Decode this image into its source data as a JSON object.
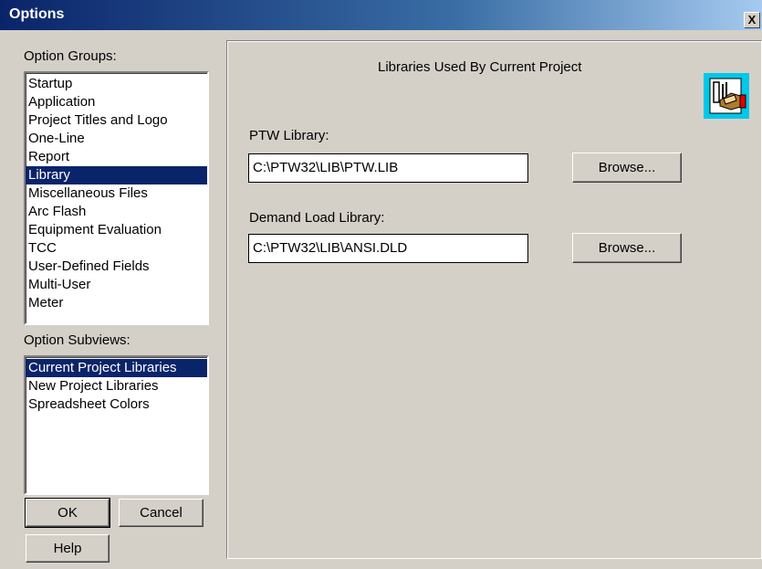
{
  "window": {
    "title": "Options",
    "close_glyph": "X"
  },
  "option_groups": {
    "label": "Option Groups:",
    "items": [
      {
        "label": "Startup",
        "selected": false
      },
      {
        "label": "Application",
        "selected": false
      },
      {
        "label": "Project Titles and Logo",
        "selected": false
      },
      {
        "label": "One-Line",
        "selected": false
      },
      {
        "label": "Report",
        "selected": false
      },
      {
        "label": "Library",
        "selected": true
      },
      {
        "label": "Miscellaneous Files",
        "selected": false
      },
      {
        "label": "Arc Flash",
        "selected": false
      },
      {
        "label": "Equipment Evaluation",
        "selected": false
      },
      {
        "label": "TCC",
        "selected": false
      },
      {
        "label": "User-Defined Fields",
        "selected": false
      },
      {
        "label": "Multi-User",
        "selected": false
      },
      {
        "label": "Meter",
        "selected": false
      }
    ]
  },
  "option_subviews": {
    "label": "Option Subviews:",
    "items": [
      {
        "label": "Current Project Libraries",
        "selected": true
      },
      {
        "label": "New Project Libraries",
        "selected": false
      },
      {
        "label": "Spreadsheet Colors",
        "selected": false
      }
    ]
  },
  "buttons": {
    "ok": "OK",
    "cancel": "Cancel",
    "help": "Help"
  },
  "panel": {
    "heading": "Libraries Used By Current Project",
    "icon": "library-book-hand-icon",
    "ptw_library": {
      "label": "PTW Library:",
      "value": "C:\\PTW32\\LIB\\PTW.LIB",
      "browse": "Browse..."
    },
    "demand_library": {
      "label": "Demand Load Library:",
      "value": "C:\\PTW32\\LIB\\ANSI.DLD",
      "browse": "Browse..."
    }
  },
  "colors": {
    "selection": "#0a246a",
    "face": "#d4d0c8",
    "icon_bg": "#00c8e8"
  }
}
